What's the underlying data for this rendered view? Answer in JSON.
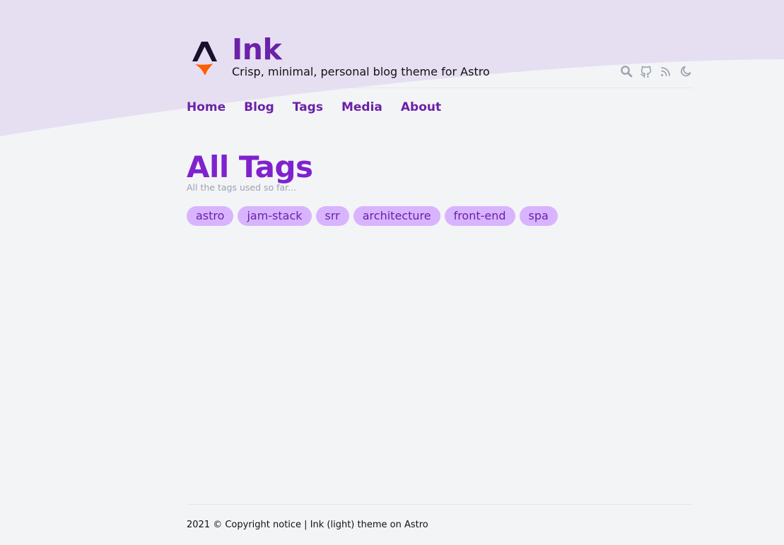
{
  "site": {
    "title": "Ink",
    "tagline": "Crisp, minimal, personal blog theme for Astro"
  },
  "header_icons": [
    "search-icon",
    "github-icon",
    "rss-icon",
    "moon-icon"
  ],
  "nav": {
    "items": [
      {
        "label": "Home"
      },
      {
        "label": "Blog"
      },
      {
        "label": "Tags"
      },
      {
        "label": "Media"
      },
      {
        "label": "About"
      }
    ]
  },
  "page": {
    "title": "All Tags",
    "subtitle": "All the tags used so far..."
  },
  "tags": [
    {
      "label": "astro"
    },
    {
      "label": "jam-stack"
    },
    {
      "label": "srr"
    },
    {
      "label": "architecture"
    },
    {
      "label": "front-end"
    },
    {
      "label": "spa"
    }
  ],
  "footer": {
    "text": "2021 © Copyright notice | Ink (light) theme on Astro"
  },
  "colors": {
    "accent": "#6b21a8",
    "title": "#7e22ce",
    "tag_background": "#d8b4fe",
    "wave": "#e6dff2",
    "background": "#f3f4f6",
    "icon": "#9ca3af"
  }
}
